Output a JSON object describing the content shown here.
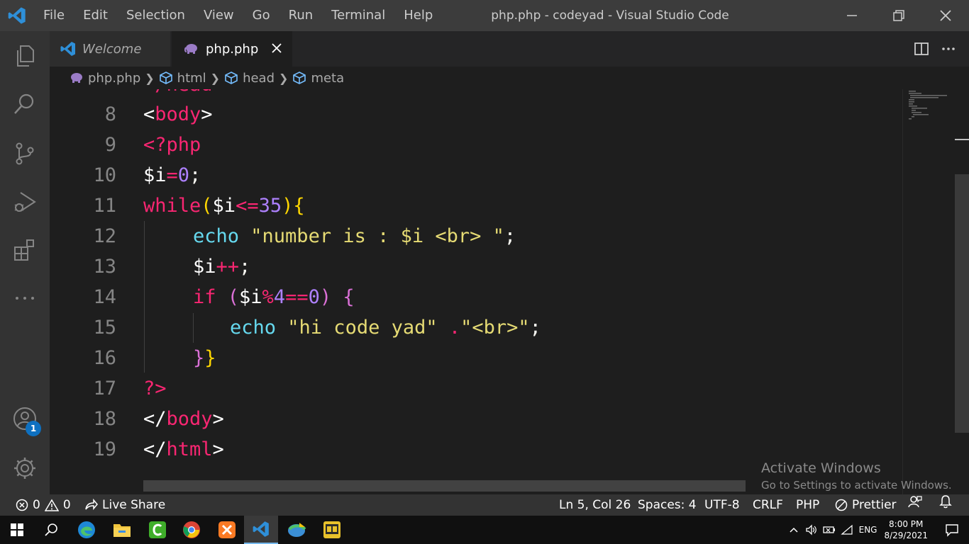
{
  "window": {
    "title": "php.php - codeyad - Visual Studio Code"
  },
  "menu": [
    "File",
    "Edit",
    "Selection",
    "View",
    "Go",
    "Run",
    "Terminal",
    "Help"
  ],
  "tabs": [
    {
      "label": "Welcome",
      "icon": "vscode-logo-icon"
    },
    {
      "label": "php.php",
      "icon": "php-elephant-icon"
    }
  ],
  "breadcrumb": [
    "php.php",
    "html",
    "head",
    "meta"
  ],
  "editor": {
    "partial_top_line": "</head>",
    "lines": [
      {
        "n": "8"
      },
      {
        "n": "9"
      },
      {
        "n": "10"
      },
      {
        "n": "11"
      },
      {
        "n": "12"
      },
      {
        "n": "13"
      },
      {
        "n": "14"
      },
      {
        "n": "15"
      },
      {
        "n": "16"
      },
      {
        "n": "17"
      },
      {
        "n": "18"
      },
      {
        "n": "19"
      }
    ],
    "tokens": {
      "l8": [
        "<",
        "body",
        ">"
      ],
      "l9": [
        "<?php"
      ],
      "l10": [
        "$i",
        "=",
        "0",
        ";"
      ],
      "l11": [
        "while",
        "(",
        "$i",
        "<=",
        "35",
        ")",
        "{"
      ],
      "l12": [
        "echo",
        " \"number is : $i <br> \"",
        ";"
      ],
      "l13": [
        "$i",
        "++",
        ";"
      ],
      "l14": [
        "if",
        " (",
        "$i",
        "%",
        "4",
        "==",
        "0",
        ")",
        " {"
      ],
      "l15": [
        "echo",
        " \"hi code yad\"",
        " .",
        "\"<br>\"",
        ";"
      ],
      "l16": [
        "}",
        "}"
      ],
      "l17": [
        "?>"
      ],
      "l18": [
        "</",
        "body",
        ">"
      ],
      "l19": [
        "</",
        "html",
        ">"
      ]
    }
  },
  "watermark": {
    "line1": "Activate Windows",
    "line2": "Go to Settings to activate Windows."
  },
  "activity_badge": "1",
  "statusbar": {
    "errors": "0",
    "warnings": "0",
    "live_share": "Live Share",
    "position": "Ln 5, Col 26",
    "spaces": "Spaces: 4",
    "encoding": "UTF-8",
    "eol": "CRLF",
    "language": "PHP",
    "formatter": "Prettier"
  },
  "taskbar": {
    "lang": "ENG",
    "time": "8:00 PM",
    "date": "8/29/2021"
  },
  "colors": {
    "accent": "#0e70c0",
    "keyword": "#f92672",
    "string": "#e6db74",
    "number": "#ae81ff",
    "function": "#66d9ef"
  }
}
